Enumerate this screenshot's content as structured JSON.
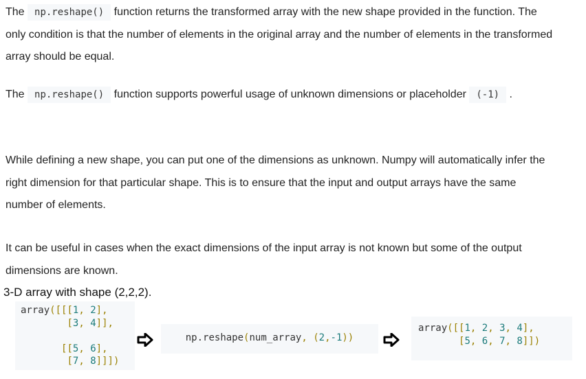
{
  "paragraphs": {
    "p1": {
      "t1": "The ",
      "code": "np.reshape()",
      "t2": " function returns the transformed array with the new shape provided in the function. The only condition is that the number of elements in the original array and the number of elements in the transformed array should be equal."
    },
    "p2": {
      "t1": "The ",
      "code": "np.reshape()",
      "t2": " function supports powerful usage of unknown dimensions or placeholder ",
      "code2": "(-1)",
      "t3": " ."
    },
    "p3": "While defining a new shape, you can put one of the dimensions as unknown. Numpy will automatically infer the right dimension for that particular shape. This is to ensure that the input and output arrays have the same number of elements.",
    "p4": "It can be useful in cases when the exact dimensions of the input array is not known but some of the output dimensions are known."
  },
  "caption": "3-D array with shape (2,2,2).",
  "diagram": {
    "input_lines": [
      "array([[[1, 2],",
      "        [3, 4]],",
      "",
      "       [[5, 6],",
      "        [7, 8]]])"
    ],
    "operation": "np.reshape(num_array, (2,-1))",
    "output_lines": [
      "array([[1, 2, 3, 4],",
      "       [5, 6, 7, 8]])"
    ],
    "arrow_icon": "right-arrow-icon"
  }
}
